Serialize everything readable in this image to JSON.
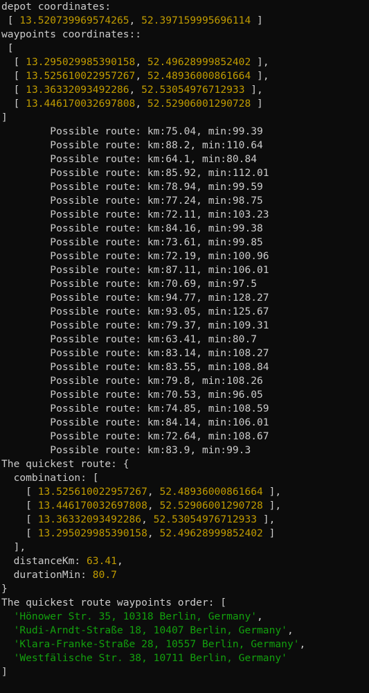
{
  "colors": {
    "background": "#0c0c0c",
    "text": "#cccccc",
    "number": "#c19c00",
    "string": "#13a10e"
  },
  "terminal": {
    "lines": [
      [
        {
          "t": "depot coordinates:",
          "c": "plain"
        }
      ],
      [
        {
          "t": " [ ",
          "c": "plain"
        },
        {
          "t": "13.520739969574265",
          "c": "num"
        },
        {
          "t": ", ",
          "c": "plain"
        },
        {
          "t": "52.397159995696114",
          "c": "num"
        },
        {
          "t": " ]",
          "c": "plain"
        }
      ],
      [
        {
          "t": "waypoints coordinates::",
          "c": "plain"
        }
      ],
      [
        {
          "t": " [",
          "c": "plain"
        }
      ],
      [
        {
          "t": "  [ ",
          "c": "plain"
        },
        {
          "t": "13.295029985390158",
          "c": "num"
        },
        {
          "t": ", ",
          "c": "plain"
        },
        {
          "t": "52.49628999852402",
          "c": "num"
        },
        {
          "t": " ],",
          "c": "plain"
        }
      ],
      [
        {
          "t": "  [ ",
          "c": "plain"
        },
        {
          "t": "13.525610022957267",
          "c": "num"
        },
        {
          "t": ", ",
          "c": "plain"
        },
        {
          "t": "52.48936000861664",
          "c": "num"
        },
        {
          "t": " ],",
          "c": "plain"
        }
      ],
      [
        {
          "t": "  [ ",
          "c": "plain"
        },
        {
          "t": "13.36332093492286",
          "c": "num"
        },
        {
          "t": ", ",
          "c": "plain"
        },
        {
          "t": "52.53054976712933",
          "c": "num"
        },
        {
          "t": " ],",
          "c": "plain"
        }
      ],
      [
        {
          "t": "  [ ",
          "c": "plain"
        },
        {
          "t": "13.446170032697808",
          "c": "num"
        },
        {
          "t": ", ",
          "c": "plain"
        },
        {
          "t": "52.52906001290728",
          "c": "num"
        },
        {
          "t": " ]",
          "c": "plain"
        }
      ],
      [
        {
          "t": "]",
          "c": "plain"
        }
      ],
      [
        {
          "t": "        Possible route: km:75.04, min:99.39",
          "c": "plain"
        }
      ],
      [
        {
          "t": "        Possible route: km:88.2, min:110.64",
          "c": "plain"
        }
      ],
      [
        {
          "t": "        Possible route: km:64.1, min:80.84",
          "c": "plain"
        }
      ],
      [
        {
          "t": "        Possible route: km:85.92, min:112.01",
          "c": "plain"
        }
      ],
      [
        {
          "t": "        Possible route: km:78.94, min:99.59",
          "c": "plain"
        }
      ],
      [
        {
          "t": "        Possible route: km:77.24, min:98.75",
          "c": "plain"
        }
      ],
      [
        {
          "t": "        Possible route: km:72.11, min:103.23",
          "c": "plain"
        }
      ],
      [
        {
          "t": "        Possible route: km:84.16, min:99.38",
          "c": "plain"
        }
      ],
      [
        {
          "t": "        Possible route: km:73.61, min:99.85",
          "c": "plain"
        }
      ],
      [
        {
          "t": "        Possible route: km:72.19, min:100.96",
          "c": "plain"
        }
      ],
      [
        {
          "t": "        Possible route: km:87.11, min:106.01",
          "c": "plain"
        }
      ],
      [
        {
          "t": "        Possible route: km:70.69, min:97.5",
          "c": "plain"
        }
      ],
      [
        {
          "t": "        Possible route: km:94.77, min:128.27",
          "c": "plain"
        }
      ],
      [
        {
          "t": "        Possible route: km:93.05, min:125.67",
          "c": "plain"
        }
      ],
      [
        {
          "t": "        Possible route: km:79.37, min:109.31",
          "c": "plain"
        }
      ],
      [
        {
          "t": "        Possible route: km:63.41, min:80.7",
          "c": "plain"
        }
      ],
      [
        {
          "t": "        Possible route: km:83.14, min:108.27",
          "c": "plain"
        }
      ],
      [
        {
          "t": "        Possible route: km:83.55, min:108.84",
          "c": "plain"
        }
      ],
      [
        {
          "t": "        Possible route: km:79.8, min:108.26",
          "c": "plain"
        }
      ],
      [
        {
          "t": "        Possible route: km:70.53, min:96.05",
          "c": "plain"
        }
      ],
      [
        {
          "t": "        Possible route: km:74.85, min:108.59",
          "c": "plain"
        }
      ],
      [
        {
          "t": "        Possible route: km:84.14, min:106.01",
          "c": "plain"
        }
      ],
      [
        {
          "t": "        Possible route: km:72.64, min:108.67",
          "c": "plain"
        }
      ],
      [
        {
          "t": "        Possible route: km:83.9, min:99.3",
          "c": "plain"
        }
      ],
      [
        {
          "t": "The quickest route: {",
          "c": "plain"
        }
      ],
      [
        {
          "t": "  combination: [",
          "c": "plain"
        }
      ],
      [
        {
          "t": "    [ ",
          "c": "plain"
        },
        {
          "t": "13.525610022957267",
          "c": "num"
        },
        {
          "t": ", ",
          "c": "plain"
        },
        {
          "t": "52.48936000861664",
          "c": "num"
        },
        {
          "t": " ],",
          "c": "plain"
        }
      ],
      [
        {
          "t": "    [ ",
          "c": "plain"
        },
        {
          "t": "13.446170032697808",
          "c": "num"
        },
        {
          "t": ", ",
          "c": "plain"
        },
        {
          "t": "52.52906001290728",
          "c": "num"
        },
        {
          "t": " ],",
          "c": "plain"
        }
      ],
      [
        {
          "t": "    [ ",
          "c": "plain"
        },
        {
          "t": "13.36332093492286",
          "c": "num"
        },
        {
          "t": ", ",
          "c": "plain"
        },
        {
          "t": "52.53054976712933",
          "c": "num"
        },
        {
          "t": " ],",
          "c": "plain"
        }
      ],
      [
        {
          "t": "    [ ",
          "c": "plain"
        },
        {
          "t": "13.295029985390158",
          "c": "num"
        },
        {
          "t": ", ",
          "c": "plain"
        },
        {
          "t": "52.49628999852402",
          "c": "num"
        },
        {
          "t": " ]",
          "c": "plain"
        }
      ],
      [
        {
          "t": "  ],",
          "c": "plain"
        }
      ],
      [
        {
          "t": "  distanceKm: ",
          "c": "plain"
        },
        {
          "t": "63.41",
          "c": "num"
        },
        {
          "t": ",",
          "c": "plain"
        }
      ],
      [
        {
          "t": "  durationMin: ",
          "c": "plain"
        },
        {
          "t": "80.7",
          "c": "num"
        }
      ],
      [
        {
          "t": "}",
          "c": "plain"
        }
      ],
      [
        {
          "t": "The quickest route waypoints order: [",
          "c": "plain"
        }
      ],
      [
        {
          "t": "  ",
          "c": "plain"
        },
        {
          "t": "'Hönower Str. 35, 10318 Berlin, Germany'",
          "c": "str"
        },
        {
          "t": ",",
          "c": "plain"
        }
      ],
      [
        {
          "t": "  ",
          "c": "plain"
        },
        {
          "t": "'Rudi-Arndt-Straße 18, 10407 Berlin, Germany'",
          "c": "str"
        },
        {
          "t": ",",
          "c": "plain"
        }
      ],
      [
        {
          "t": "  ",
          "c": "plain"
        },
        {
          "t": "'Klara-Franke-Straße 28, 10557 Berlin, Germany'",
          "c": "str"
        },
        {
          "t": ",",
          "c": "plain"
        }
      ],
      [
        {
          "t": "  ",
          "c": "plain"
        },
        {
          "t": "'Westfälische Str. 38, 10711 Berlin, Germany'",
          "c": "str"
        }
      ],
      [
        {
          "t": "]",
          "c": "plain"
        }
      ]
    ]
  }
}
